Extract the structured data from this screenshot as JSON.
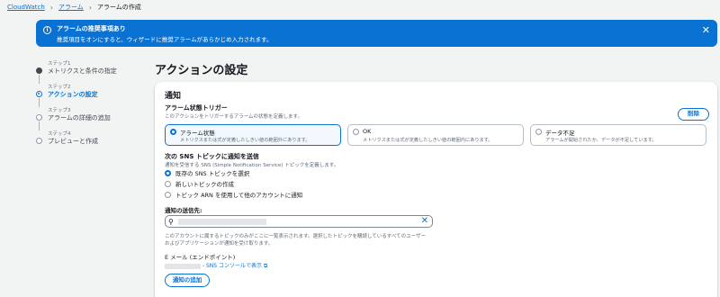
{
  "breadcrumb": {
    "root": "CloudWatch",
    "alarms": "アラーム",
    "current": "アラームの作成"
  },
  "flash": {
    "title": "アラームの推奨事項あり",
    "message": "推奨項目をオンにすると、ウィザードに推奨アラームがあらかじめ入力されます。",
    "close": "✕",
    "color": "#0972d3"
  },
  "steps": [
    {
      "label": "ステップ1",
      "text": "メトリクスと条件の指定",
      "state": "done"
    },
    {
      "label": "ステップ2",
      "text": "アクションの設定",
      "state": "active"
    },
    {
      "label": "ステップ3",
      "text": "アラームの詳細の追加",
      "state": "pending"
    },
    {
      "label": "ステップ4",
      "text": "プレビューと作成",
      "state": "pending"
    }
  ],
  "page_title": "アクションの設定",
  "notification": {
    "heading": "通知",
    "remove_button": "削除",
    "trigger": {
      "title": "アラーム状態トリガー",
      "desc": "このアクションをトリガーするアラームの状態を定義します。",
      "tiles": [
        {
          "title": "アラーム状態",
          "desc": "メトリクスまたは式が定義したしきい値の範囲外にあります。",
          "selected": true
        },
        {
          "title": "OK",
          "desc": "メトリクスまたは式が定義したしきい値の範囲内にあります。",
          "selected": false
        },
        {
          "title": "データ不足",
          "desc": "アラームが開始されたか、データが不足しています。",
          "selected": false
        }
      ]
    },
    "sns": {
      "title": "次の SNS トピックに通知を送信",
      "desc": "通知を受信する SNS (Simple Notification Service) トピックを定義します。",
      "options": [
        {
          "label": "既存の SNS トピックを選択",
          "selected": true
        },
        {
          "label": "新しいトピックの作成",
          "selected": false
        },
        {
          "label": "トピック ARN を使用して他のアカウントに通知",
          "selected": false
        }
      ]
    },
    "recipient": {
      "title": "通知の送信先:",
      "search_icon": "search-icon",
      "clear_icon": "close-icon",
      "help1": "このアカウントに属するトピックのみがここに一覧表示されます。選択したトピックを購読しているすべてのユーザー",
      "help2": "およびアプリケーションが通知を受け取ります。"
    },
    "email": {
      "title": "E メール (エンドポイント)",
      "link_text": "- SNS コンソールで表示",
      "ext_icon": "external-link-icon"
    },
    "add_button": "通知の追加"
  }
}
